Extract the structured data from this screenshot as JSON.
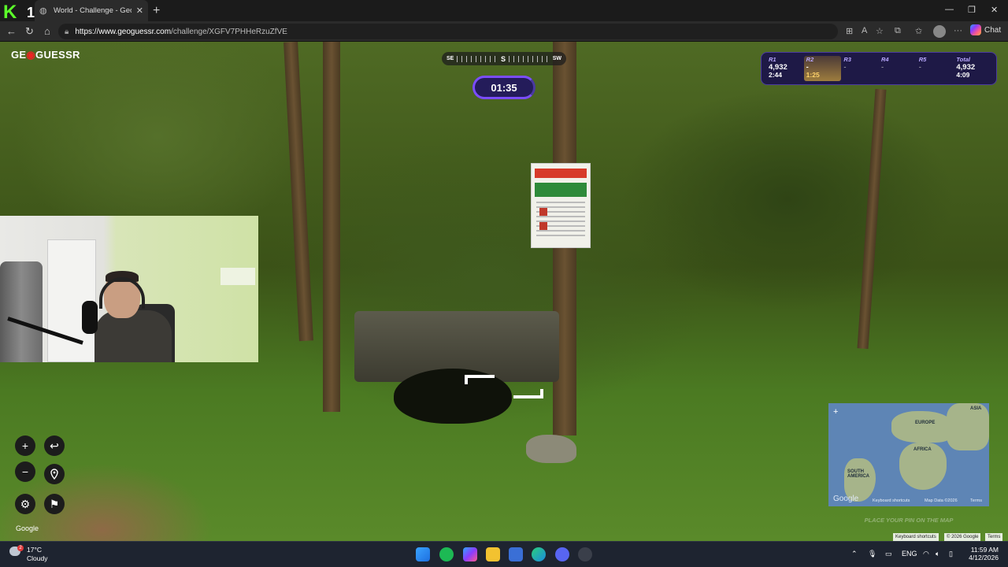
{
  "browser": {
    "tab_title": "World - Challenge - GeoGues",
    "tab_close": "✕",
    "new_tab": "+",
    "url_domain": "https://www.geoguessr.com",
    "url_path": "/challenge/XGFV7PHHeRzuZfVE",
    "chat_label": "Chat",
    "window_min": "—",
    "window_max": "❐",
    "window_close": "✕"
  },
  "overlay_badge": {
    "k": "K",
    "one": "1"
  },
  "game": {
    "logo_left": "GE",
    "logo_pin": "◉",
    "logo_right": "GUESSR",
    "compass": {
      "left": "SE",
      "center": "S",
      "right": "SW"
    },
    "timer": "01:35",
    "rounds": [
      {
        "label": "R1",
        "points": "4,932",
        "time": "2:44"
      },
      {
        "label": "R2",
        "points": "-",
        "time": "1:25"
      },
      {
        "label": "R3",
        "points": "-",
        "time": ""
      },
      {
        "label": "R4",
        "points": "-",
        "time": ""
      },
      {
        "label": "R5",
        "points": "-",
        "time": ""
      },
      {
        "label": "Total",
        "points": "4,932",
        "time": "4:09"
      }
    ],
    "google_brand": "Google",
    "minimap": {
      "labels": {
        "europe": "EUROPE",
        "africa": "AFRICA",
        "south_america": "SOUTH AMERICA",
        "asia": "ASIA"
      },
      "keyboard": "Keyboard shortcuts",
      "map_data": "Map Data ©2026",
      "terms": "Terms",
      "place_pin": "PLACE YOUR PIN ON THE MAP"
    },
    "street_footer": {
      "keyboard": "Keyboard shortcuts",
      "copyright": "© 2026 Google",
      "terms": "Terms"
    }
  },
  "taskbar": {
    "temperature": "17°C",
    "condition": "Cloudy",
    "weather_badge": "2",
    "language": "ENG",
    "time": "11:59 AM",
    "date": "4/12/2026"
  },
  "colors": {
    "accent": "#7b4dff",
    "logo_pin": "#e22222",
    "k1_green": "#5cff2a"
  }
}
